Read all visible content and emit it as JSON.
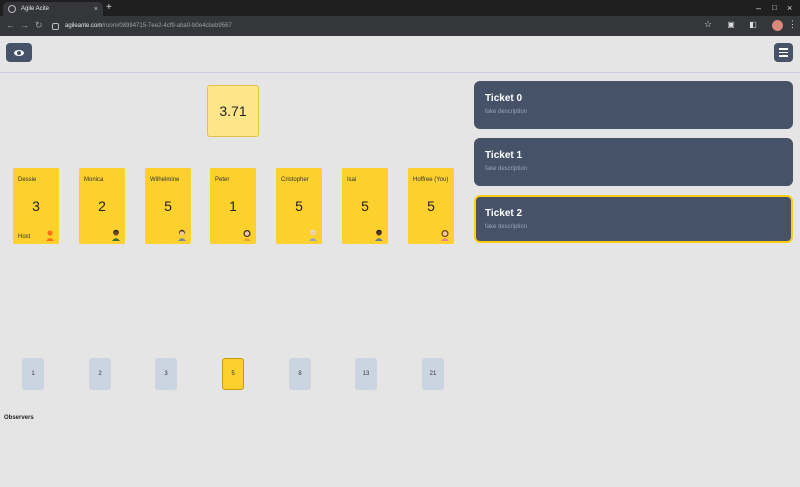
{
  "browser": {
    "tab_title": "Agile Acite",
    "tab_close": "×",
    "new_tab": "+",
    "minimize": "–",
    "maximize": "□",
    "close": "×",
    "url_host": "agileante.com",
    "url_path": "/room/08984715-7ee2-4cf9-aba0-b0e4cbeb9567",
    "profile_initial": "A"
  },
  "room": {
    "average": "3.71",
    "observers_label": "Observers",
    "host_label": "Host"
  },
  "players": [
    {
      "name": "Dessie",
      "vote": "3",
      "avatar": "orange-person-icon",
      "skin": "#f97316",
      "hair": "#f97316",
      "host": true
    },
    {
      "name": "Monica",
      "vote": "2",
      "avatar": "dark-person-icon",
      "skin": "#6b4a2b",
      "hair": "#1f1f1f"
    },
    {
      "name": "Wilhelmine",
      "vote": "5",
      "avatar": "person-icon",
      "skin": "#f2c9a0",
      "hair": "#3a2a1a"
    },
    {
      "name": "Peter",
      "vote": "1",
      "avatar": "woman-icon",
      "skin": "#f2c9a0",
      "hair": "#3a2a1a"
    },
    {
      "name": "Cristopher",
      "vote": "5",
      "avatar": "elder-icon",
      "skin": "#f2c9a0",
      "hair": "#e5e5e5"
    },
    {
      "name": "Isai",
      "vote": "5",
      "avatar": "dark-person-icon",
      "skin": "#5b3a22",
      "hair": "#1f1f1f"
    },
    {
      "name": "Hoffree (You)",
      "vote": "5",
      "avatar": "woman-icon",
      "skin": "#f2c9a0",
      "hair": "#6b3a1f"
    }
  ],
  "tickets": [
    {
      "title": "Ticket 0",
      "description": "fake description",
      "active": false
    },
    {
      "title": "Ticket 1",
      "description": "fake description",
      "active": false
    },
    {
      "title": "Ticket 2",
      "description": "fake description",
      "active": true
    }
  ],
  "deck": [
    {
      "value": "1",
      "selected": false
    },
    {
      "value": "2",
      "selected": false
    },
    {
      "value": "3",
      "selected": false
    },
    {
      "value": "5",
      "selected": true
    },
    {
      "value": "8",
      "selected": false
    },
    {
      "value": "13",
      "selected": false
    },
    {
      "value": "21",
      "selected": false
    }
  ],
  "colors": {
    "card_yellow": "#fcd02d",
    "ticket_bg": "#455268",
    "active_border": "#facc15",
    "deck_bg": "#cbd5e1"
  }
}
